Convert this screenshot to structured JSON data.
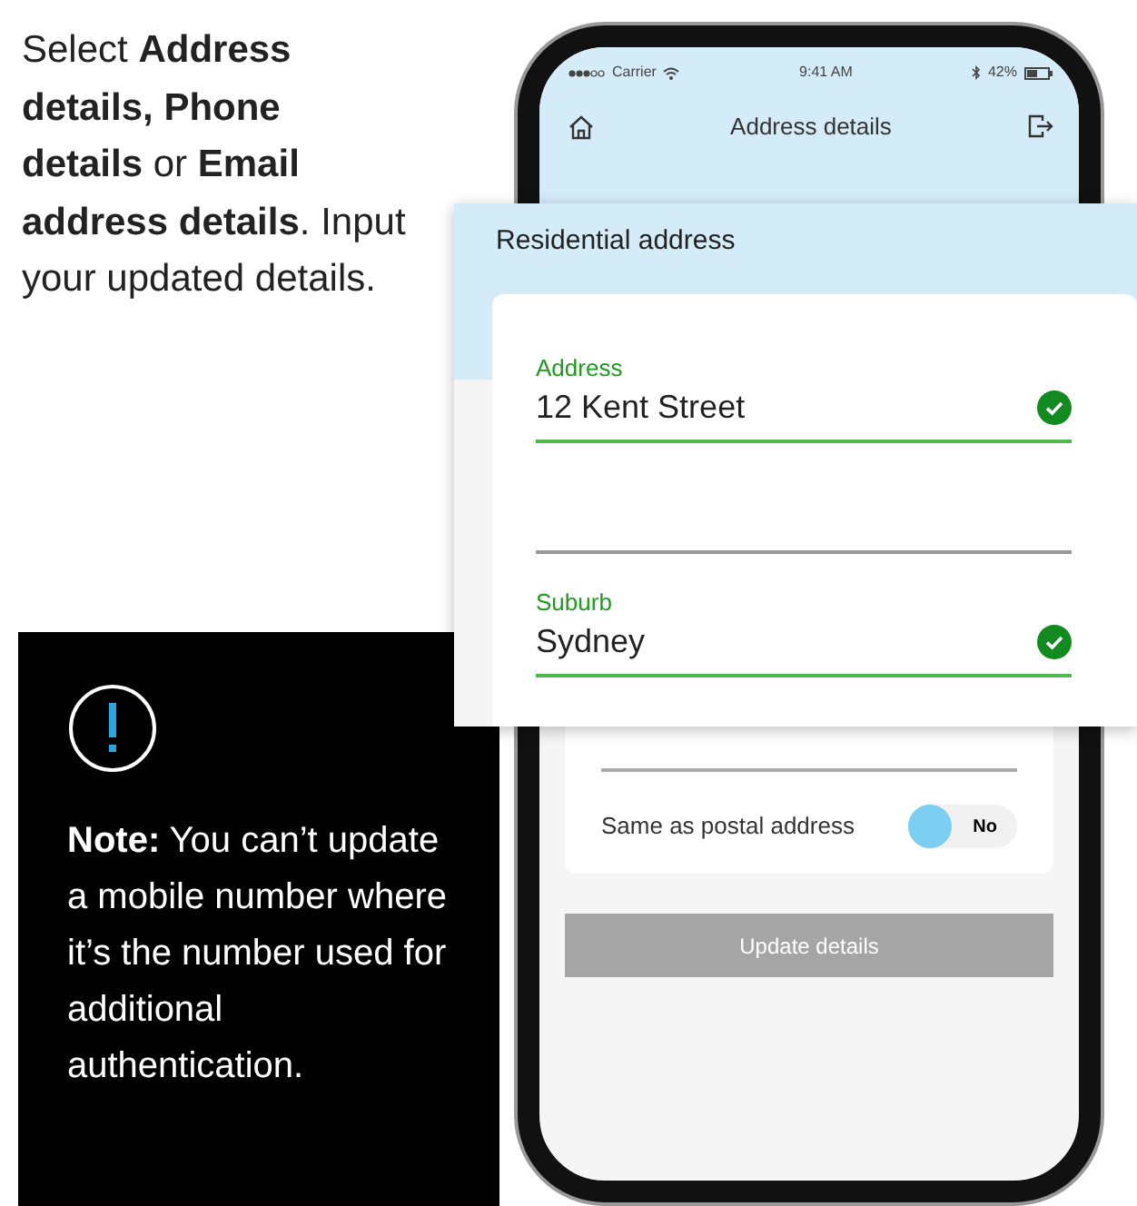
{
  "instructions": {
    "text": "Select **Address details, Phone details** or **Email address details**. Input your updated details."
  },
  "note": {
    "text": "**Note:** You can’t update a mobile number where it’s the number used for additional authentication."
  },
  "phone": {
    "status_bar": {
      "carrier": "Carrier",
      "time": "9:41 AM",
      "battery": "42%"
    },
    "header": {
      "title": "Address details"
    },
    "postal_toggle": {
      "label": "Same as postal address",
      "on": false,
      "value": "No"
    },
    "button": {
      "label": "Update details",
      "disabled": true
    }
  },
  "magnified": {
    "section_title": "Residential address",
    "fields": [
      {
        "kind": "filled",
        "label": "Address",
        "value": "12 Kent Street",
        "valid": true
      },
      {
        "kind": "blank",
        "valid": false
      },
      {
        "kind": "filled",
        "label": "Suburb",
        "value": "Sydney",
        "valid": true
      }
    ]
  }
}
